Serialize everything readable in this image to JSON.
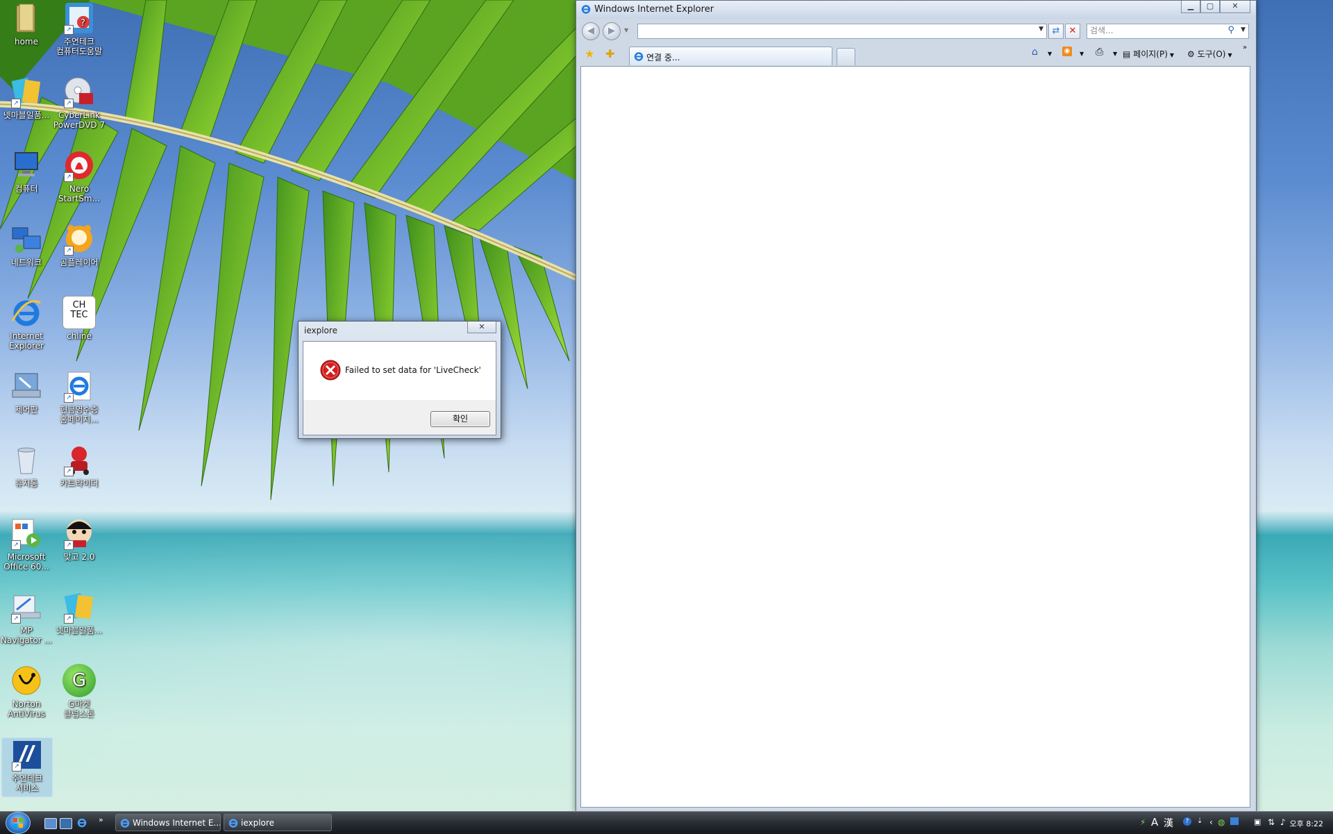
{
  "desktop": {
    "icons": [
      {
        "label": "home"
      },
      {
        "label": "주연테크 컴퓨터도움말"
      },
      {
        "label": "넷마블일품..."
      },
      {
        "label": "CyberLink PowerDVD 7"
      },
      {
        "label": "컴퓨터"
      },
      {
        "label": "Nero StartSm..."
      },
      {
        "label": "네트워크"
      },
      {
        "label": "곰플레이어"
      },
      {
        "label": "Internet Explorer"
      },
      {
        "label": "chline"
      },
      {
        "label": "제어판"
      },
      {
        "label": "현금영수증 홈페이지..."
      },
      {
        "label": "휴지통"
      },
      {
        "label": "카트라이더"
      },
      {
        "label": "Microsoft Office 60..."
      },
      {
        "label": "맞고 2.0"
      },
      {
        "label": "MP Navigator ..."
      },
      {
        "label": "넷마블일품..."
      },
      {
        "label": "Norton AntiVirus"
      },
      {
        "label": "G마켓 클럽스톤"
      },
      {
        "label": "주연테크 서비스"
      }
    ],
    "chline_icon_text": "CH TEC",
    "gmarket_icon_text": "G"
  },
  "ie": {
    "window_title": "Windows Internet Explorer",
    "address_value": "",
    "search_placeholder": "검색...",
    "tab_label": "연결 중...",
    "commands": {
      "page": "페이지(P)",
      "tools": "도구(O)"
    },
    "chevron": "»"
  },
  "dialog": {
    "title": "iexplore",
    "message": "Failed to set data for 'LiveCheck'",
    "ok_label": "확인"
  },
  "taskbar": {
    "buttons": [
      {
        "label": "Windows Internet E..."
      },
      {
        "label": "iexplore"
      }
    ],
    "quicklaunch_more": "»",
    "tray_ime_mode": "A",
    "tray_ime_hanja": "漢",
    "clock": "오후 8:22"
  },
  "colors": {
    "accent": "#2f5fb0",
    "error_red": "#d11f1f"
  }
}
